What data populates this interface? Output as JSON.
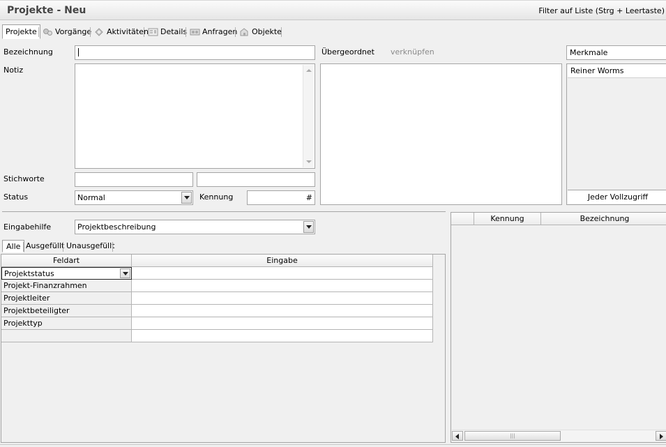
{
  "window": {
    "title": "Projekte - Neu",
    "filter_hint": "Filter auf Liste (Strg + Leertaste)"
  },
  "tabs": [
    {
      "label": "Projekte",
      "icon": "folder-icon"
    },
    {
      "label": "Vorgänge",
      "icon": "process-icon"
    },
    {
      "label": "Aktivitäten",
      "icon": "activity-icon"
    },
    {
      "label": "Details",
      "icon": "details-icon"
    },
    {
      "label": "Anfragen",
      "icon": "request-icon"
    },
    {
      "label": "Objekte",
      "icon": "object-icon"
    }
  ],
  "form": {
    "bezeichnung_label": "Bezeichnung",
    "bezeichnung_value": "",
    "notiz_label": "Notiz",
    "notiz_value": "",
    "stichworte_label": "Stichworte",
    "stichworte_value1": "",
    "stichworte_value2": "",
    "status_label": "Status",
    "status_value": "Normal",
    "kennung_label": "Kennung",
    "kennung_value": "#",
    "uebergeordnet_label": "Übergeordnet",
    "verknuepfen_link": "verknüpfen"
  },
  "merkmale": {
    "header": "Merkmale",
    "items": [
      "Reiner Worms"
    ],
    "footer_button": "Jeder Vollzugriff"
  },
  "eingabehilfe": {
    "label": "Eingabehilfe",
    "value": "Projektbeschreibung",
    "filter_tabs": [
      "Alle",
      "Ausgefüllt",
      "Unausgefüllt"
    ],
    "columns": [
      "Feldart",
      "Eingabe"
    ],
    "rows": [
      {
        "feldart": "Projektstatus",
        "eingabe": ""
      },
      {
        "feldart": "Projekt-Finanzrahmen",
        "eingabe": ""
      },
      {
        "feldart": "Projektleiter",
        "eingabe": ""
      },
      {
        "feldart": "Projektbeteiligter",
        "eingabe": ""
      },
      {
        "feldart": "Projekttyp",
        "eingabe": ""
      },
      {
        "feldart": "",
        "eingabe": ""
      }
    ]
  },
  "right_list": {
    "columns": [
      "",
      "Kennung",
      "Bezeichnung"
    ]
  }
}
